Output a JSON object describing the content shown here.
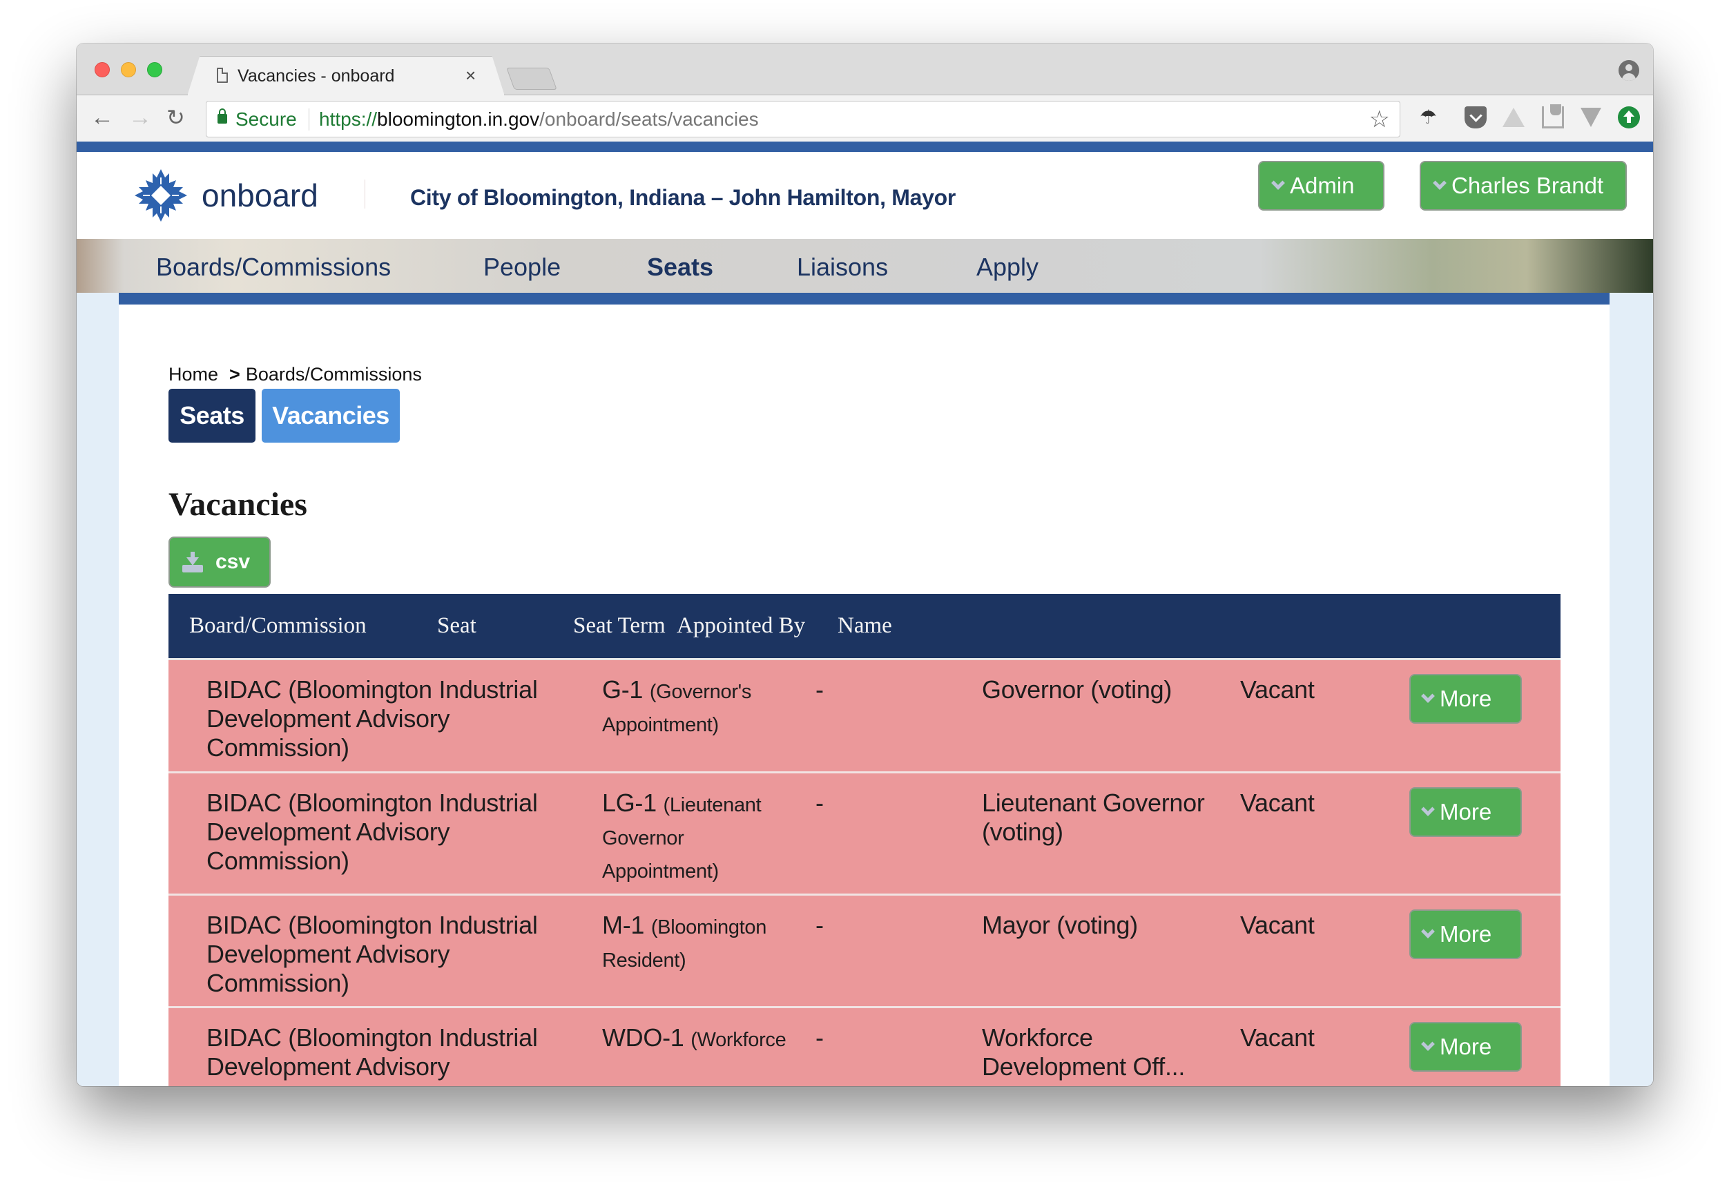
{
  "browser": {
    "tab_title": "Vacancies - onboard",
    "tab_close": "×",
    "secure_label": "Secure",
    "url_scheme": "https://",
    "url_host": "bloomington.in.gov",
    "url_path": "/onboard/seats/vacancies",
    "back_glyph": "←",
    "forward_glyph": "→",
    "reload_glyph": "↻",
    "star_glyph": "☆",
    "umbrella_glyph": "☂"
  },
  "header": {
    "logo_text": "onboard",
    "city_title": "City of Bloomington, Indiana – John Hamilton, Mayor",
    "admin_label": "Admin",
    "user_label": "Charles Brandt"
  },
  "nav": {
    "items": [
      {
        "label": "Boards/Commissions",
        "active": false
      },
      {
        "label": "People",
        "active": false
      },
      {
        "label": "Seats",
        "active": true
      },
      {
        "label": "Liaisons",
        "active": false
      },
      {
        "label": "Apply",
        "active": false
      }
    ]
  },
  "breadcrumb": {
    "items": [
      "Home",
      "Boards/Commissions"
    ],
    "separator": ">"
  },
  "subtabs": {
    "seats_label": "Seats",
    "vacancies_label": "Vacancies",
    "active": "Vacancies"
  },
  "main": {
    "heading": "Vacancies",
    "csv_label": "csv"
  },
  "table": {
    "columns": [
      "Board/Commission",
      "Seat",
      "Seat Term",
      "Appointed By",
      "Name"
    ],
    "more_label": "More",
    "rows": [
      {
        "board": "BIDAC (Bloomington Industrial Development Advisory Commission)",
        "seat_code": "G-1",
        "seat_desc": "(Governor's Appointment)",
        "term": "-",
        "appointed_by": "Governor (voting)",
        "name": "Vacant"
      },
      {
        "board": "BIDAC (Bloomington Industrial Development Advisory Commission)",
        "seat_code": "LG-1",
        "seat_desc": "(Lieutenant Governor Appointment)",
        "term": "-",
        "appointed_by": "Lieutenant Governor (voting)",
        "name": "Vacant"
      },
      {
        "board": "BIDAC (Bloomington Industrial Development Advisory Commission)",
        "seat_code": "M-1",
        "seat_desc": "(Bloomington Resident)",
        "term": "-",
        "appointed_by": "Mayor (voting)",
        "name": "Vacant"
      },
      {
        "board": "BIDAC (Bloomington Industrial Development Advisory Commission)",
        "seat_code": "WDO-1",
        "seat_desc": "(Workforce",
        "term": "-",
        "appointed_by": "Workforce Development Off...",
        "name": "Vacant"
      }
    ]
  },
  "colors": {
    "brand_navy": "#1c3461",
    "brand_blue": "#325fa3",
    "vacancies_tab": "#4e92dd",
    "button_green": "#52ae56",
    "vacant_row": "#eb989a",
    "secure_green": "#1e7b34"
  }
}
